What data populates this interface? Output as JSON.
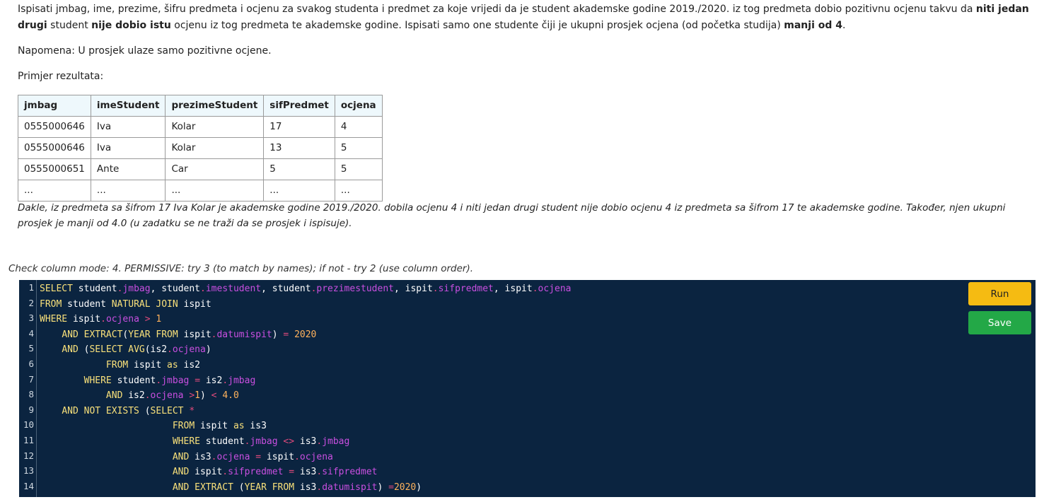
{
  "task": {
    "intro_parts": [
      {
        "text": "Ispisati jmbag, ime, prezime, šifru predmeta i ocjenu za svakog studenta i predmet za koje vrijedi da je student akademske godine 2019./2020. iz tog predmeta dobio pozitivnu ocjenu takvu da ",
        "bold": false
      },
      {
        "text": "niti jedan drugi",
        "bold": true
      },
      {
        "text": " student ",
        "bold": false
      },
      {
        "text": "nije dobio istu",
        "bold": true
      },
      {
        "text": " ocjenu iz tog predmeta te akademske godine. Ispisati samo one studente čiji je ukupni prosjek ocjena (od početka studija) ",
        "bold": false
      },
      {
        "text": "manji od 4",
        "bold": true
      },
      {
        "text": ".",
        "bold": false
      }
    ],
    "note": "Napomena: U prosjek ulaze samo pozitivne ocjene.",
    "example_label": "Primjer rezultata:",
    "table": {
      "headers": [
        "jmbag",
        "imeStudent",
        "prezimeStudent",
        "sifPredmet",
        "ocjena"
      ],
      "rows": [
        [
          "0555000646",
          "Iva",
          "Kolar",
          "17",
          "4"
        ],
        [
          "0555000646",
          "Iva",
          "Kolar",
          "13",
          "5"
        ],
        [
          "0555000651",
          "Ante",
          "Car",
          "5",
          "5"
        ],
        [
          "...",
          "...",
          "...",
          "...",
          "..."
        ]
      ]
    },
    "explanation": "Dakle, iz predmeta sa šifrom 17 Iva Kolar je akademske godine 2019./2020. dobila ocjenu 4 i niti jedan drugi student nije dobio ocjenu 4 iz predmeta sa šifrom 17 te akademske godine. Također, njen ukupni prosjek je manji od 4.0 (u zadatku se ne traži da se prosjek i ispisuje)."
  },
  "check_mode": "Check column mode: 4. PERMISSIVE: try 3 (to match by names); if not - try 2 (use column order).",
  "buttons": {
    "run": "Run",
    "save": "Save"
  },
  "colors": {
    "editor_bg": "#0b2440",
    "keyword": "#f8e07a",
    "property": "#c94fe0",
    "operator": "#e14a7c",
    "number": "#ffb25c",
    "run_button": "#f5bb12",
    "save_button": "#23a847"
  },
  "code_lines": [
    [
      [
        "t",
        "SELECT"
      ],
      [
        "x",
        " student"
      ],
      [
        "o",
        "."
      ],
      [
        "p",
        "jmbag"
      ],
      [
        "x",
        ", student"
      ],
      [
        "o",
        "."
      ],
      [
        "p",
        "imestudent"
      ],
      [
        "x",
        ", student"
      ],
      [
        "o",
        "."
      ],
      [
        "p",
        "prezimestudent"
      ],
      [
        "x",
        ", ispit"
      ],
      [
        "o",
        "."
      ],
      [
        "p",
        "sifpredmet"
      ],
      [
        "x",
        ", ispit"
      ],
      [
        "o",
        "."
      ],
      [
        "p",
        "ocjena"
      ]
    ],
    [
      [
        "t",
        "FROM"
      ],
      [
        "x",
        " student "
      ],
      [
        "t",
        "NATURAL JOIN"
      ],
      [
        "x",
        " ispit"
      ]
    ],
    [
      [
        "t",
        "WHERE"
      ],
      [
        "x",
        " ispit"
      ],
      [
        "o",
        "."
      ],
      [
        "p",
        "ocjena"
      ],
      [
        "x",
        " "
      ],
      [
        "o",
        ">"
      ],
      [
        "x",
        " "
      ],
      [
        "n",
        "1"
      ]
    ],
    [
      [
        "x",
        "    "
      ],
      [
        "t",
        "AND EXTRACT"
      ],
      [
        "x",
        "("
      ],
      [
        "t",
        "YEAR FROM"
      ],
      [
        "x",
        " ispit"
      ],
      [
        "o",
        "."
      ],
      [
        "p",
        "datumispit"
      ],
      [
        "x",
        ") "
      ],
      [
        "o",
        "="
      ],
      [
        "x",
        " "
      ],
      [
        "n",
        "2020"
      ]
    ],
    [
      [
        "x",
        "    "
      ],
      [
        "t",
        "AND"
      ],
      [
        "x",
        " ("
      ],
      [
        "t",
        "SELECT AVG"
      ],
      [
        "x",
        "(is2"
      ],
      [
        "o",
        "."
      ],
      [
        "p",
        "ocjena"
      ],
      [
        "x",
        ")"
      ]
    ],
    [
      [
        "x",
        "            "
      ],
      [
        "t",
        "FROM"
      ],
      [
        "x",
        " ispit "
      ],
      [
        "t",
        "as"
      ],
      [
        "x",
        " is2"
      ]
    ],
    [
      [
        "x",
        "        "
      ],
      [
        "t",
        "WHERE"
      ],
      [
        "x",
        " student"
      ],
      [
        "o",
        "."
      ],
      [
        "p",
        "jmbag"
      ],
      [
        "x",
        " "
      ],
      [
        "o",
        "="
      ],
      [
        "x",
        " is2"
      ],
      [
        "o",
        "."
      ],
      [
        "p",
        "jmbag"
      ]
    ],
    [
      [
        "x",
        "            "
      ],
      [
        "t",
        "AND"
      ],
      [
        "x",
        " is2"
      ],
      [
        "o",
        "."
      ],
      [
        "p",
        "ocjena"
      ],
      [
        "x",
        " "
      ],
      [
        "o",
        ">"
      ],
      [
        "n",
        "1"
      ],
      [
        "x",
        ") "
      ],
      [
        "o",
        "<"
      ],
      [
        "x",
        " "
      ],
      [
        "n",
        "4.0"
      ]
    ],
    [
      [
        "x",
        "    "
      ],
      [
        "t",
        "AND NOT EXISTS"
      ],
      [
        "x",
        " ("
      ],
      [
        "t",
        "SELECT"
      ],
      [
        "x",
        " "
      ],
      [
        "o",
        "*"
      ]
    ],
    [
      [
        "x",
        "                        "
      ],
      [
        "t",
        "FROM"
      ],
      [
        "x",
        " ispit "
      ],
      [
        "t",
        "as"
      ],
      [
        "x",
        " is3"
      ]
    ],
    [
      [
        "x",
        "                        "
      ],
      [
        "t",
        "WHERE"
      ],
      [
        "x",
        " student"
      ],
      [
        "o",
        "."
      ],
      [
        "p",
        "jmbag"
      ],
      [
        "x",
        " "
      ],
      [
        "o",
        "<>"
      ],
      [
        "x",
        " is3"
      ],
      [
        "o",
        "."
      ],
      [
        "p",
        "jmbag"
      ]
    ],
    [
      [
        "x",
        "                        "
      ],
      [
        "t",
        "AND"
      ],
      [
        "x",
        " is3"
      ],
      [
        "o",
        "."
      ],
      [
        "p",
        "ocjena"
      ],
      [
        "x",
        " "
      ],
      [
        "o",
        "="
      ],
      [
        "x",
        " ispit"
      ],
      [
        "o",
        "."
      ],
      [
        "p",
        "ocjena"
      ]
    ],
    [
      [
        "x",
        "                        "
      ],
      [
        "t",
        "AND"
      ],
      [
        "x",
        " ispit"
      ],
      [
        "o",
        "."
      ],
      [
        "p",
        "sifpredmet"
      ],
      [
        "x",
        " "
      ],
      [
        "o",
        "="
      ],
      [
        "x",
        " is3"
      ],
      [
        "o",
        "."
      ],
      [
        "p",
        "sifpredmet"
      ]
    ],
    [
      [
        "x",
        "                        "
      ],
      [
        "t",
        "AND EXTRACT"
      ],
      [
        "x",
        " ("
      ],
      [
        "t",
        "YEAR FROM"
      ],
      [
        "x",
        " is3"
      ],
      [
        "o",
        "."
      ],
      [
        "p",
        "datumispit"
      ],
      [
        "x",
        ") "
      ],
      [
        "o",
        "="
      ],
      [
        "n",
        "2020"
      ],
      [
        "x",
        ")"
      ]
    ]
  ],
  "line_numbers": [
    "1",
    "2",
    "3",
    "4",
    "5",
    "6",
    "7",
    "8",
    "9",
    "10",
    "11",
    "12",
    "13",
    "14"
  ]
}
